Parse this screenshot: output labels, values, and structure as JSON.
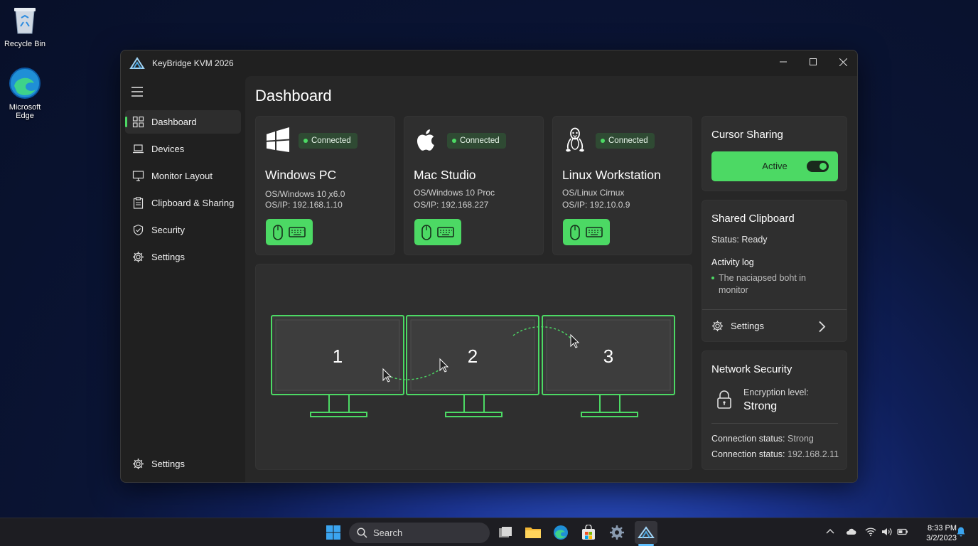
{
  "desktop": {
    "icons": [
      {
        "label": "Recycle Bin"
      },
      {
        "label": "Microsoft Edge"
      }
    ]
  },
  "window": {
    "title": "KeyBridge KVM 2026"
  },
  "sidebar": {
    "items": [
      {
        "label": "Dashboard",
        "icon": "dashboard-icon",
        "active": true
      },
      {
        "label": "Devices",
        "icon": "laptop-icon"
      },
      {
        "label": "Monitor Layout",
        "icon": "monitor-icon"
      },
      {
        "label": "Clipboard & Sharing",
        "icon": "clipboard-icon"
      },
      {
        "label": "Security",
        "icon": "shield-icon"
      },
      {
        "label": "Settings",
        "icon": "gear-icon"
      }
    ],
    "footer": {
      "label": "Settings",
      "icon": "gear-icon"
    }
  },
  "page": {
    "title": "Dashboard"
  },
  "devices": [
    {
      "name": "Windows PC",
      "status": "Connected",
      "os": "OS/Windows 10 ꭗ6.0",
      "ip": "OS/IP: 192.168.1.10",
      "logo": "windows-logo-icon"
    },
    {
      "name": "Mac Studio",
      "status": "Connected",
      "os": "OS/Windows 10 Proc",
      "ip": "OS/IP: 192.168.227",
      "logo": "apple-logo-icon"
    },
    {
      "name": "Linux Workstation",
      "status": "Connected",
      "os": "OS/Linux Cirnux",
      "ip": "OS/IP: 192.10.0.9",
      "logo": "linux-logo-icon"
    }
  ],
  "monitors": [
    "1",
    "2",
    "3"
  ],
  "cursor_sharing": {
    "title": "Cursor Sharing",
    "button": "Active",
    "on": true
  },
  "shared_clipboard": {
    "title": "Shared Clipboard",
    "status": "Status: Ready",
    "log_title": "Activity log",
    "log_items": [
      "The naciapsed boht in monitor"
    ],
    "settings_label": "Settings"
  },
  "network_security": {
    "title": "Network Security",
    "encryption_label": "Encryption level:",
    "encryption_value": "Strong",
    "status_1_label": "Connection status:",
    "status_1_value": "Strong",
    "status_2_label": "Connection status:",
    "status_2_value": "192.168.2.11"
  },
  "taskbar": {
    "search_placeholder": "Search",
    "time": "8:33 PM",
    "date": "3/2/2023"
  },
  "colors": {
    "accent": "#4cd964",
    "window_bg": "#202020",
    "card_bg": "#2f2f2f"
  }
}
